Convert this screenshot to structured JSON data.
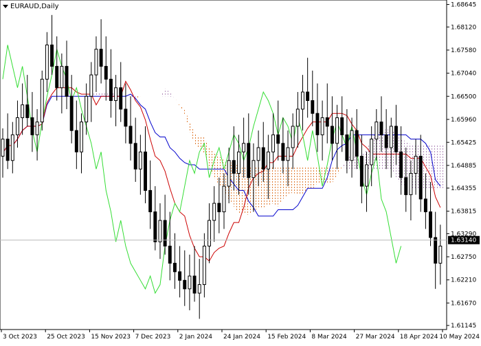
{
  "symbol_label": "EURAUD,Daily",
  "price_tag": "1.63140",
  "chart_data": {
    "type": "candlestick",
    "title": "EURAUD,Daily",
    "ylim": [
      1.6105,
      1.6875
    ],
    "y_ticks": [
      "1.68645",
      "1.68120",
      "1.67580",
      "1.67040",
      "1.66500",
      "1.65960",
      "1.65425",
      "1.64885",
      "1.64355",
      "1.63815",
      "1.63290",
      "1.62750",
      "1.62210",
      "1.61670",
      "1.61145"
    ],
    "x_ticks": [
      "3 Oct 2023",
      "25 Oct 2023",
      "15 Nov 2023",
      "7 Dec 2023",
      "2 Jan 2024",
      "24 Jan 2024",
      "15 Feb 2024",
      "8 Mar 2024",
      "27 Mar 2024",
      "18 Apr 2024",
      "10 May 2024"
    ],
    "current_price": 1.6314,
    "candles": [
      [
        1.651,
        1.6575,
        1.646,
        1.655
      ],
      [
        1.655,
        1.661,
        1.648,
        1.65
      ],
      [
        1.65,
        1.659,
        1.647,
        1.656
      ],
      [
        1.656,
        1.664,
        1.653,
        1.66
      ],
      [
        1.66,
        1.668,
        1.656,
        1.663
      ],
      [
        1.663,
        1.67,
        1.658,
        1.66
      ],
      [
        1.66,
        1.666,
        1.652,
        1.656
      ],
      [
        1.656,
        1.662,
        1.65,
        1.659
      ],
      [
        1.659,
        1.671,
        1.657,
        1.669
      ],
      [
        1.669,
        1.68,
        1.666,
        1.677
      ],
      [
        1.677,
        1.684,
        1.67,
        1.672
      ],
      [
        1.672,
        1.679,
        1.664,
        1.667
      ],
      [
        1.667,
        1.675,
        1.661,
        1.672
      ],
      [
        1.672,
        1.678,
        1.662,
        1.665
      ],
      [
        1.665,
        1.67,
        1.654,
        1.657
      ],
      [
        1.657,
        1.664,
        1.648,
        1.652
      ],
      [
        1.652,
        1.661,
        1.647,
        1.659
      ],
      [
        1.659,
        1.668,
        1.656,
        1.665
      ],
      [
        1.665,
        1.673,
        1.659,
        1.67
      ],
      [
        1.67,
        1.679,
        1.666,
        1.676
      ],
      [
        1.676,
        1.683,
        1.668,
        1.672
      ],
      [
        1.672,
        1.679,
        1.664,
        1.669
      ],
      [
        1.669,
        1.676,
        1.66,
        1.664
      ],
      [
        1.664,
        1.67,
        1.658,
        1.667
      ],
      [
        1.667,
        1.673,
        1.659,
        1.662
      ],
      [
        1.662,
        1.668,
        1.654,
        1.658
      ],
      [
        1.658,
        1.665,
        1.65,
        1.654
      ],
      [
        1.654,
        1.66,
        1.645,
        1.648
      ],
      [
        1.648,
        1.656,
        1.642,
        1.652
      ],
      [
        1.652,
        1.658,
        1.64,
        1.643
      ],
      [
        1.643,
        1.65,
        1.634,
        1.638
      ],
      [
        1.638,
        1.644,
        1.629,
        1.631
      ],
      [
        1.631,
        1.64,
        1.627,
        1.636
      ],
      [
        1.636,
        1.642,
        1.628,
        1.63
      ],
      [
        1.63,
        1.638,
        1.622,
        1.626
      ],
      [
        1.626,
        1.633,
        1.62,
        1.624
      ],
      [
        1.624,
        1.63,
        1.618,
        1.622
      ],
      [
        1.622,
        1.629,
        1.616,
        1.62
      ],
      [
        1.62,
        1.628,
        1.615,
        1.623
      ],
      [
        1.623,
        1.63,
        1.617,
        1.619
      ],
      [
        1.619,
        1.627,
        1.613,
        1.621
      ],
      [
        1.621,
        1.633,
        1.618,
        1.63
      ],
      [
        1.63,
        1.64,
        1.626,
        1.636
      ],
      [
        1.636,
        1.644,
        1.631,
        1.64
      ],
      [
        1.64,
        1.646,
        1.633,
        1.638
      ],
      [
        1.638,
        1.647,
        1.634,
        1.644
      ],
      [
        1.644,
        1.653,
        1.64,
        1.65
      ],
      [
        1.65,
        1.658,
        1.643,
        1.647
      ],
      [
        1.647,
        1.656,
        1.642,
        1.652
      ],
      [
        1.652,
        1.66,
        1.646,
        1.654
      ],
      [
        1.654,
        1.661,
        1.642,
        1.646
      ],
      [
        1.646,
        1.654,
        1.638,
        1.65
      ],
      [
        1.65,
        1.657,
        1.644,
        1.653
      ],
      [
        1.653,
        1.659,
        1.645,
        1.648
      ],
      [
        1.648,
        1.656,
        1.641,
        1.652
      ],
      [
        1.652,
        1.661,
        1.648,
        1.656
      ],
      [
        1.656,
        1.664,
        1.65,
        1.654
      ],
      [
        1.654,
        1.66,
        1.647,
        1.65
      ],
      [
        1.65,
        1.657,
        1.644,
        1.653
      ],
      [
        1.653,
        1.661,
        1.648,
        1.658
      ],
      [
        1.658,
        1.666,
        1.653,
        1.662
      ],
      [
        1.662,
        1.67,
        1.657,
        1.666
      ],
      [
        1.666,
        1.674,
        1.66,
        1.664
      ],
      [
        1.664,
        1.671,
        1.658,
        1.661
      ],
      [
        1.661,
        1.668,
        1.652,
        1.656
      ],
      [
        1.656,
        1.664,
        1.65,
        1.66
      ],
      [
        1.66,
        1.668,
        1.654,
        1.658
      ],
      [
        1.658,
        1.665,
        1.65,
        1.654
      ],
      [
        1.654,
        1.663,
        1.648,
        1.66
      ],
      [
        1.66,
        1.665,
        1.652,
        1.656
      ],
      [
        1.656,
        1.662,
        1.647,
        1.65
      ],
      [
        1.65,
        1.66,
        1.646,
        1.657
      ],
      [
        1.657,
        1.662,
        1.648,
        1.651
      ],
      [
        1.651,
        1.656,
        1.64,
        1.644
      ],
      [
        1.644,
        1.652,
        1.638,
        1.649
      ],
      [
        1.649,
        1.658,
        1.644,
        1.655
      ],
      [
        1.655,
        1.662,
        1.65,
        1.659
      ],
      [
        1.659,
        1.665,
        1.652,
        1.656
      ],
      [
        1.656,
        1.662,
        1.648,
        1.653
      ],
      [
        1.653,
        1.66,
        1.646,
        1.658
      ],
      [
        1.658,
        1.663,
        1.649,
        1.652
      ],
      [
        1.652,
        1.658,
        1.642,
        1.646
      ],
      [
        1.646,
        1.653,
        1.638,
        1.642
      ],
      [
        1.642,
        1.65,
        1.636,
        1.647
      ],
      [
        1.647,
        1.655,
        1.642,
        1.651
      ],
      [
        1.651,
        1.656,
        1.638,
        1.641
      ],
      [
        1.641,
        1.647,
        1.634,
        1.638
      ],
      [
        1.638,
        1.645,
        1.63,
        1.632
      ],
      [
        1.632,
        1.638,
        1.62,
        1.626
      ],
      [
        1.626,
        1.635,
        1.621,
        1.63
      ]
    ]
  }
}
